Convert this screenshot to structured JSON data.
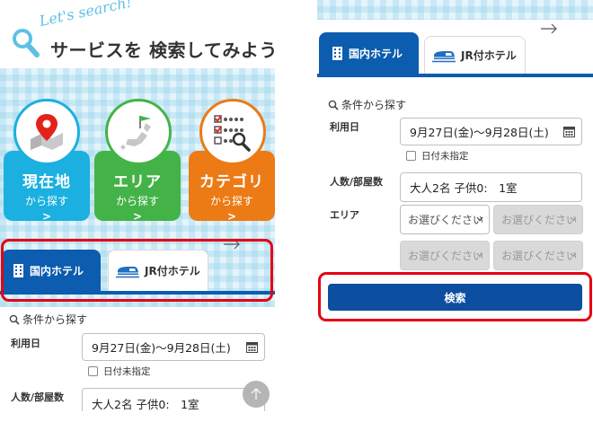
{
  "hero": {
    "script_text": "Let's search!",
    "title": "サービスを 検索してみよう!"
  },
  "tiles": [
    {
      "main": "現在地",
      "sub": "から探す",
      "chevron": ">",
      "color": "#1bb0df",
      "icon": "map-pin-icon"
    },
    {
      "main": "エリア",
      "sub": "から探す",
      "chevron": ">",
      "color": "#44b347",
      "icon": "japan-map-flag-icon"
    },
    {
      "main": "カテゴリ",
      "sub": "から探す",
      "chevron": ">",
      "color": "#ec7a15",
      "icon": "category-checklist-icon"
    }
  ],
  "tabs": {
    "domestic": "国内ホテル",
    "jr": "JR付ホテル"
  },
  "form": {
    "section_title": "条件から探す",
    "date_label": "利用日",
    "date_value": "9月27日(金)〜9月28日(土)",
    "date_unset": "日付未指定",
    "guests_label": "人数/部屋数",
    "guests_value": "大人2名 子供0:　1室",
    "area_label": "エリア",
    "area_placeholder": "お選びください",
    "search_button": "検索"
  },
  "colors": {
    "primary_blue": "#0c5caf",
    "search_button": "#0c4ea0",
    "highlight_red": "#e60012"
  }
}
